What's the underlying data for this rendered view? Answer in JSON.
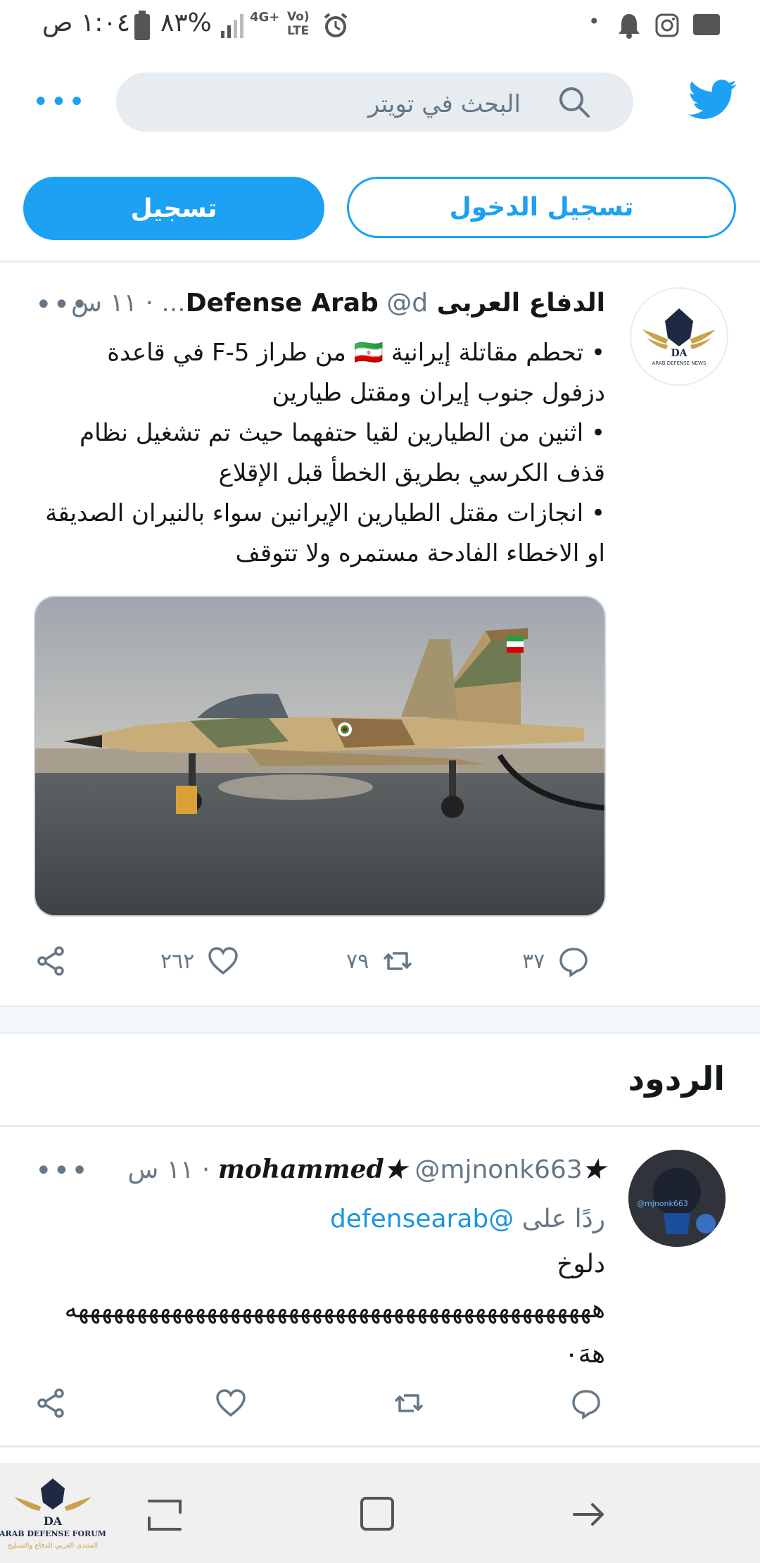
{
  "status_bar": {
    "time": "١:٠٤ ص",
    "battery": "%٨٣",
    "network": "4G+",
    "volte": "Vo) LTE",
    "dot": "•"
  },
  "header": {
    "search_placeholder": "البحث في تويتر",
    "more_label": "•••"
  },
  "auth": {
    "login_label": "تسجيل الدخول",
    "signup_label": "تسجيل"
  },
  "tweet": {
    "name": "الدفاع العربى Defense Arab",
    "handle": "@d...",
    "time": "١١ س",
    "line1": "• تحطم مقاتلة إيرانية 🇮🇷 من طراز F-5 في قاعدة دزفول جنوب إيران ومقتل طيارين",
    "line2": "• اثنين من الطيارين لقيا حتفهما حيث تم تشغيل نظام قذف الكرسي بطريق الخطأ قبل الإقلاع",
    "line3": "• انجازات مقتل الطيارين الإيرانين سواء بالنيران الصديقة او الاخطاء الفادحة مستمره ولا تتوقف",
    "replies": "٣٧",
    "retweets": "٧٩",
    "likes": "٢٦٢",
    "avatar_text": "ARAB DEFENSE NEWS",
    "avatar_mark": "DA"
  },
  "replies_section": {
    "title": "الردود"
  },
  "reply": {
    "name": "★mohammed★",
    "handle": "@mjnonk663",
    "time": "١١ س",
    "replying_prefix": "ردًا على",
    "replying_handle": "@defensearab",
    "text1": "دلوخ",
    "text2": "هههههههههههههههههههههههههههههههههههههههههههههه",
    "text3": "ههَ٠",
    "avatar_handle": "@mjnonk663"
  },
  "watermark": {
    "mark": "DA",
    "line1": "ARAB DEFENSE FORUM",
    "line2": "المنتدى العربي للدفاع والتسليح"
  },
  "colors": {
    "accent": "#1da1f2",
    "muted": "#657786"
  }
}
